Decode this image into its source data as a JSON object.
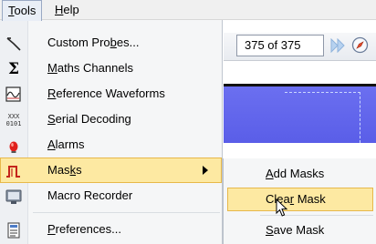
{
  "menubar": {
    "items": [
      {
        "name": "menu-tools",
        "pre": "",
        "ul": "T",
        "post": "ools",
        "open": true
      },
      {
        "name": "menu-help",
        "pre": "",
        "ul": "H",
        "post": "elp",
        "open": false
      }
    ]
  },
  "app": {
    "page_counter": "375 of 375"
  },
  "tools_menu": {
    "items": [
      {
        "name": "menu-item-custom-probes",
        "icon": "probe-icon",
        "pre": "Custom Pro",
        "ul": "b",
        "post": "es...",
        "submenu": false,
        "active": false
      },
      {
        "name": "menu-item-maths-channels",
        "icon": "sigma-icon",
        "pre": "",
        "ul": "M",
        "post": "aths Channels",
        "submenu": false,
        "active": false
      },
      {
        "name": "menu-item-reference-waveforms",
        "icon": "waveform-icon",
        "pre": "",
        "ul": "R",
        "post": "eference Waveforms",
        "submenu": false,
        "active": false
      },
      {
        "name": "menu-item-serial-decoding",
        "icon": "serial-decoding-icon",
        "pre": "",
        "ul": "S",
        "post": "erial Decoding",
        "submenu": false,
        "active": false
      },
      {
        "name": "menu-item-alarms",
        "icon": "alarm-icon",
        "pre": "",
        "ul": "A",
        "post": "larms",
        "submenu": false,
        "active": false
      },
      {
        "name": "menu-item-masks",
        "icon": "mask-pulse-icon",
        "pre": "Mas",
        "ul": "k",
        "post": "s",
        "submenu": true,
        "active": true
      },
      {
        "name": "menu-item-macro-recorder",
        "icon": "macro-recorder-icon",
        "pre": "Macro Recorder",
        "ul": "",
        "post": "",
        "submenu": false,
        "active": false
      },
      {
        "name": "menu-item-preferences",
        "icon": "preferences-icon",
        "pre": "",
        "ul": "P",
        "post": "references...",
        "submenu": false,
        "active": false
      }
    ]
  },
  "masks_submenu": {
    "items": [
      {
        "name": "submenu-item-add-masks",
        "pre": "",
        "ul": "A",
        "post": "dd Masks",
        "active": false
      },
      {
        "name": "submenu-item-clear-mask",
        "pre": "Clea",
        "ul": "r",
        "post": " Mask",
        "active": true
      },
      {
        "name": "submenu-item-save-mask",
        "pre": "",
        "ul": "S",
        "post": "ave Mask",
        "active": false
      }
    ]
  },
  "icons": {
    "sigma_glyph": "Σ",
    "serial_top": "XXX",
    "serial_bottom": "0101"
  },
  "colors": {
    "highlight_bg": "#fde9a2",
    "highlight_border": "#e7b84a",
    "scope_blue": "#5a5ee8",
    "alarm_red": "#e0201c",
    "masks_red": "#c4261c"
  }
}
